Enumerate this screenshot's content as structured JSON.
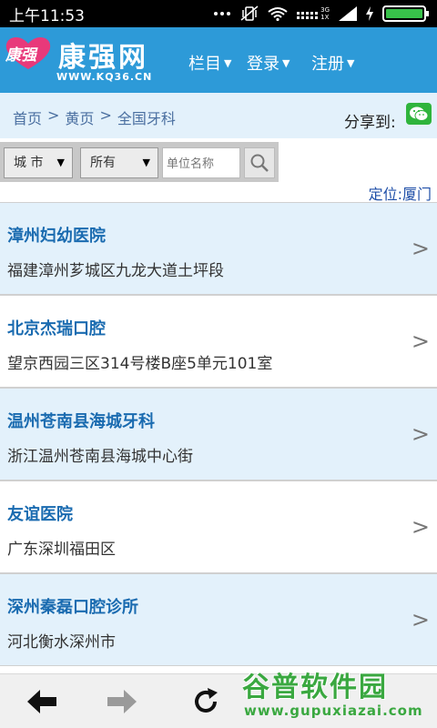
{
  "status_bar": {
    "time": "上午11:53",
    "network_type": "3G",
    "network_sub": "1X",
    "icons": [
      "dots-icon",
      "vibrate-icon",
      "wifi-icon",
      "signal-icon",
      "battery-icon"
    ]
  },
  "header": {
    "logo_badge": "康强",
    "logo_main": "康强网",
    "logo_url": "WWW.KQ36.CN",
    "nav": [
      {
        "label": "栏目"
      },
      {
        "label": "登录"
      },
      {
        "label": "注册"
      }
    ],
    "bg_color": "#2d9ad8"
  },
  "breadcrumb": {
    "items": [
      "首页",
      "黄页",
      "全国牙科"
    ],
    "separator": ">"
  },
  "share": {
    "label": "分享到:",
    "icon": "wechat-icon"
  },
  "search": {
    "city_select": "城 市",
    "type_select": "所有",
    "name_placeholder": "单位名称"
  },
  "location": {
    "label": "定位:",
    "city": "厦门"
  },
  "list": [
    {
      "name": "漳州妇幼医院",
      "address": "福建漳州芗城区九龙大道土坪段"
    },
    {
      "name": "北京杰瑞口腔",
      "address": "望京西园三区314号楼B座5单元101室"
    },
    {
      "name": "温州苍南县海城牙科",
      "address": "浙江温州苍南县海城中心街"
    },
    {
      "name": "友谊医院",
      "address": "广东深圳福田区"
    },
    {
      "name": "深州秦磊口腔诊所",
      "address": "河北衡水深州市"
    }
  ],
  "list_arrow": ">",
  "toolbar": {
    "buttons": [
      "back-icon",
      "forward-icon",
      "reload-icon"
    ]
  },
  "watermark": {
    "main": "谷普软件园",
    "url": "www.gupuxiazai.com"
  }
}
